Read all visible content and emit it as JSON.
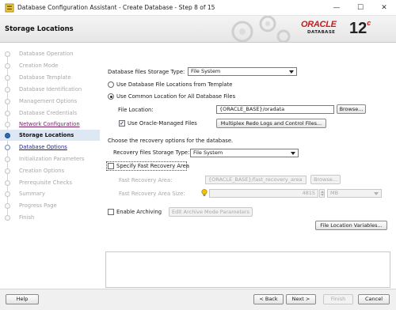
{
  "window": {
    "title": "Database Configuration Assistant - Create Database - Step 8 of 15",
    "minimize_glyph": "—",
    "maximize_glyph": "☐",
    "close_glyph": "✕"
  },
  "header": {
    "page_title": "Storage Locations",
    "logo_word": "ORACLE",
    "logo_sub": "DATABASE",
    "version": "12",
    "version_suffix": "c"
  },
  "sidebar": {
    "steps": [
      {
        "label": "Database Operation",
        "state": "done"
      },
      {
        "label": "Creation Mode",
        "state": "done"
      },
      {
        "label": "Database Template",
        "state": "done"
      },
      {
        "label": "Database Identification",
        "state": "done"
      },
      {
        "label": "Management Options",
        "state": "done"
      },
      {
        "label": "Database Credentials",
        "state": "done"
      },
      {
        "label": "Network Configuration",
        "state": "link"
      },
      {
        "label": "Storage Locations",
        "state": "current"
      },
      {
        "label": "Database Options",
        "state": "nav"
      },
      {
        "label": "Initialization Parameters",
        "state": "pending"
      },
      {
        "label": "Creation Options",
        "state": "pending"
      },
      {
        "label": "Prerequisite Checks",
        "state": "pending"
      },
      {
        "label": "Summary",
        "state": "pending"
      },
      {
        "label": "Progress Page",
        "state": "pending"
      },
      {
        "label": "Finish",
        "state": "pending"
      }
    ]
  },
  "main": {
    "storage_type_label": "Database files Storage Type:",
    "storage_type_value": "File System",
    "radio_template_label": "Use Database File Locations from Template",
    "radio_common_label": "Use Common Location for All Database Files",
    "file_location_label": "File Location:",
    "file_location_value": "{ORACLE_BASE}/oradata",
    "browse_label": "Browse...",
    "omf_label": "Use Oracle-Managed Files",
    "multiplex_label": "Multiplex Redo Logs and Control Files...",
    "recovery_heading": "Choose the recovery options for the database.",
    "recovery_type_label": "Recovery files Storage Type:",
    "recovery_type_value": "File System",
    "fra_check_label": "Specify Fast Recovery Area",
    "fra_label": "Fast Recovery Area:",
    "fra_value": "{ORACLE_BASE}/fast_recovery_area",
    "fra_browse_label": "Browse...",
    "fra_size_label": "Fast Recovery Area Size:",
    "fra_size_value": "4815",
    "fra_size_unit": "MB",
    "archiving_label": "Enable Archiving",
    "archive_params_label": "Edit Archive Mode Parameters",
    "file_loc_vars_label": "File Location Variables..."
  },
  "footer": {
    "help_label": "Help",
    "back_label": "< Back",
    "next_label": "Next >",
    "finish_label": "Finish",
    "cancel_label": "Cancel"
  },
  "colors": {
    "oracle_red": "#d21818",
    "current_step_bg": "#dde8f4",
    "link_purple": "#7a1f6a",
    "nav_blue": "#1e1e99"
  }
}
